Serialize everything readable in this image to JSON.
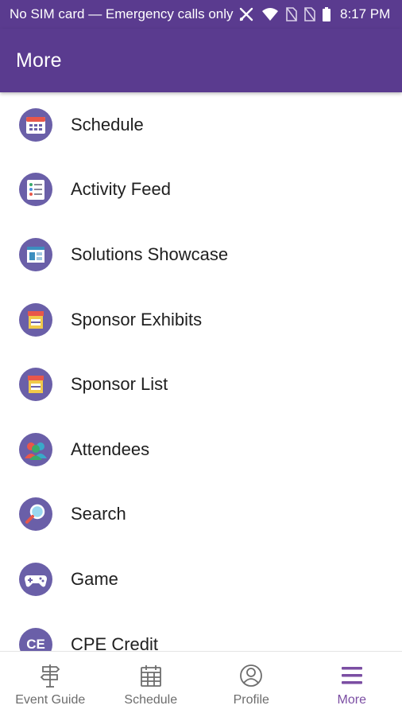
{
  "status_bar": {
    "carrier": "No SIM card — Emergency calls only",
    "time": "8:17 PM"
  },
  "app_bar": {
    "title": "More"
  },
  "colors": {
    "primary": "#5a3b8f",
    "active_nav": "#7b4ea3",
    "icon_bg": "#6a5fa8"
  },
  "menu": [
    {
      "label": "Schedule",
      "icon": "calendar-icon"
    },
    {
      "label": "Activity Feed",
      "icon": "checklist-icon"
    },
    {
      "label": "Solutions Showcase",
      "icon": "showcase-icon"
    },
    {
      "label": "Sponsor Exhibits",
      "icon": "storefront-icon"
    },
    {
      "label": "Sponsor List",
      "icon": "storefront-icon"
    },
    {
      "label": "Attendees",
      "icon": "people-icon"
    },
    {
      "label": "Search",
      "icon": "magnifier-icon"
    },
    {
      "label": "Game",
      "icon": "gamepad-icon"
    },
    {
      "label": "CPE Credit",
      "icon": "ce-badge-icon",
      "icon_text": "CE"
    }
  ],
  "bottom_nav": [
    {
      "label": "Event Guide",
      "icon": "signpost-icon",
      "active": false
    },
    {
      "label": "Schedule",
      "icon": "calendar-icon",
      "active": false
    },
    {
      "label": "Profile",
      "icon": "person-icon",
      "active": false
    },
    {
      "label": "More",
      "icon": "menu-icon",
      "active": true
    }
  ]
}
